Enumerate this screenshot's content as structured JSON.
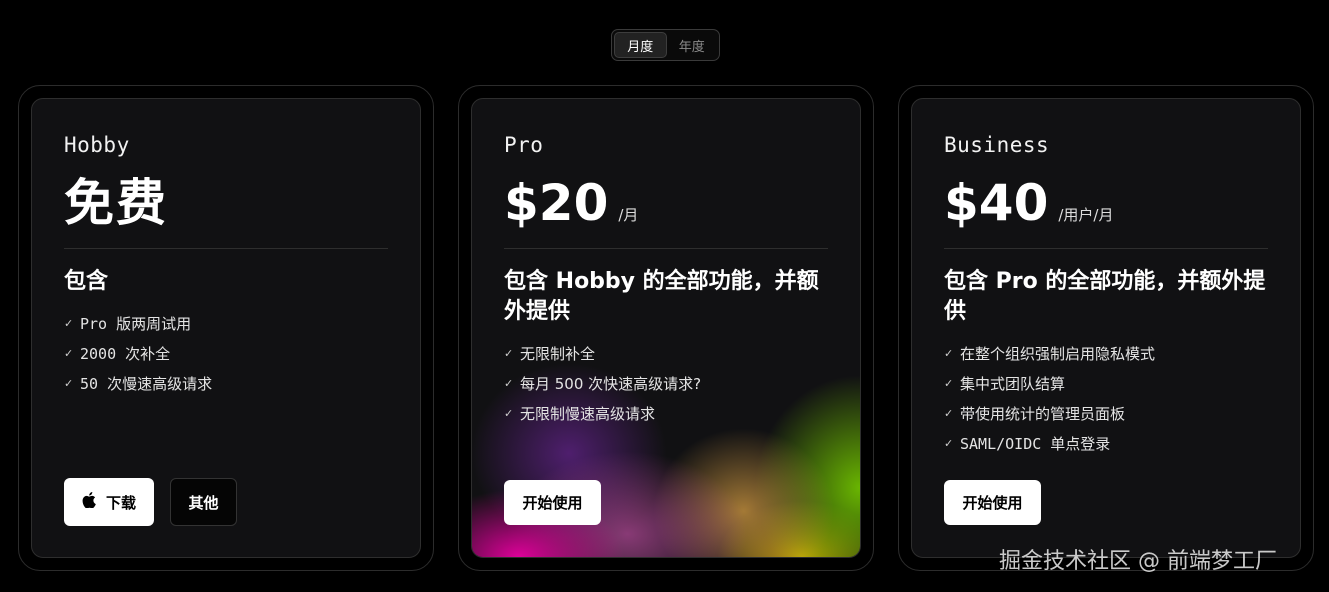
{
  "billing_toggle": {
    "monthly": "月度",
    "yearly": "年度",
    "selected": "monthly"
  },
  "plans": [
    {
      "tier": "Hobby",
      "price": "免费",
      "period": "",
      "includes_title": "包含",
      "features": [
        "Pro 版两周试用",
        "2000 次补全",
        "50 次慢速高级请求"
      ],
      "primary_button": {
        "label": "下载",
        "icon": "apple-icon"
      },
      "secondary_button": {
        "label": "其他"
      }
    },
    {
      "tier": "Pro",
      "price": "$20",
      "period": "/月",
      "includes_title": "包含 Hobby 的全部功能，并额外提供",
      "features": [
        "无限制补全",
        "每月 500 次快速高级请求?",
        "无限制慢速高级请求"
      ],
      "primary_button": {
        "label": "开始使用"
      }
    },
    {
      "tier": "Business",
      "price": "$40",
      "period": "/用户/月",
      "includes_title": "包含 Pro 的全部功能，并额外提供",
      "features": [
        "在整个组织强制启用隐私模式",
        "集中式团队结算",
        "带使用统计的管理员面板",
        "SAML/OIDC 单点登录"
      ],
      "primary_button": {
        "label": "开始使用"
      }
    }
  ],
  "check_icon": "check-icon",
  "watermark": "掘金技术社区 @ 前端梦工厂"
}
